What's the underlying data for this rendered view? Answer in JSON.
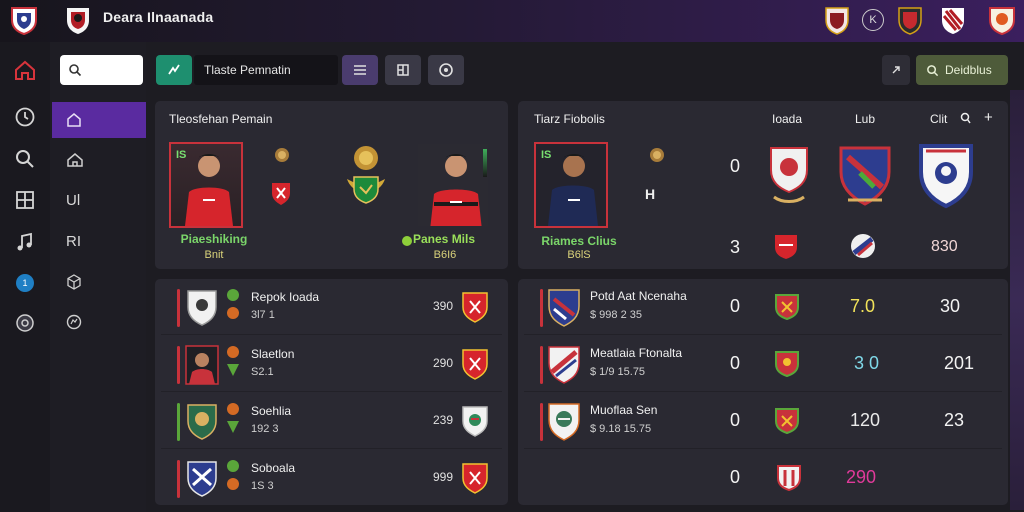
{
  "header": {
    "title": "Deara Ilnaanada",
    "logos": [
      "club-crest-blue",
      "club-crest-red",
      "club-crest-maroon",
      "club-crest-k",
      "club-crest-red-shield",
      "club-crest-stripes",
      "club-crest-orange"
    ]
  },
  "sidebar": {
    "icons": [
      "home-icon",
      "clock-icon",
      "search-icon",
      "grid-icon",
      "music-icon",
      "info-badge-icon",
      "disc-icon"
    ],
    "subnav": [
      {
        "icon": "house-outline-icon",
        "label": ""
      },
      {
        "icon": "home-outline-icon",
        "label": ""
      },
      {
        "icon": "",
        "label": "Ul"
      },
      {
        "icon": "",
        "label": "RI"
      },
      {
        "icon": "cube-icon",
        "label": ""
      },
      {
        "icon": "chat-icon",
        "label": ""
      }
    ]
  },
  "toolbar": {
    "search_placeholder": "",
    "tactic_label": "Tlaste Pemnatin",
    "details_label": "Deidblus"
  },
  "left_panel": {
    "title": "Tleosfehan Pemain",
    "home": {
      "number": "IS",
      "name": "Piaeshiking",
      "sub": "Bnit"
    },
    "away": {
      "name": "Panes Mils",
      "sub": "B6I6"
    },
    "players": [
      {
        "name": "Repok Ioada",
        "sub": "3l7 1",
        "value": "390"
      },
      {
        "name": "Slaetlon",
        "sub": "S2.1",
        "value": "290"
      },
      {
        "name": "Soehlia",
        "sub": "192 3",
        "value": "239"
      },
      {
        "name": "Soboala",
        "sub": "1S 3",
        "value": "999"
      }
    ]
  },
  "right_panel": {
    "title": "Tiarz Fiobolis",
    "col_headers": [
      "Ioada",
      "Lub",
      "Clit"
    ],
    "home": {
      "number": "IS",
      "name": "Riames Clius",
      "sub": "B6lS",
      "initials": "H"
    },
    "top_nums": [
      "0",
      "3"
    ],
    "top_last": [
      "",
      "830"
    ],
    "rows": [
      {
        "name": "Potd Aat Ncenaha",
        "sub": "$ 998 2 35",
        "col1": "0",
        "col3": "7.0",
        "col4": "30",
        "col3_color": "#f1e25a"
      },
      {
        "name": "Meatlaia Ftonalta",
        "sub": "$ 1/9 15.75",
        "col1": "0",
        "col3": "3 0",
        "col4": "201",
        "col3_color": "#7fd8e8"
      },
      {
        "name": "Muoflaa Sen",
        "sub": "$ 9.18 15.75",
        "col1": "0",
        "col3": "120",
        "col4": "23",
        "col3_color": "#eaeaea"
      },
      {
        "name": "",
        "sub": "",
        "col1": "0",
        "col3": "290",
        "col4": "",
        "col3_color": "#e03a9a"
      }
    ]
  }
}
